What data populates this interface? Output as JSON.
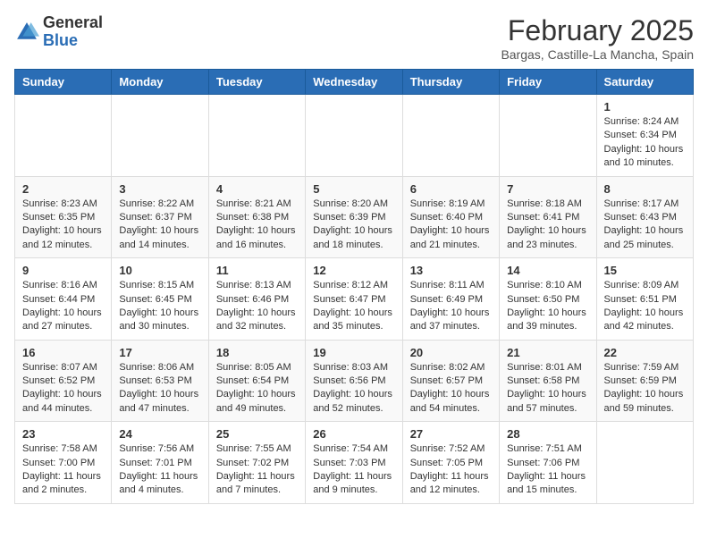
{
  "header": {
    "logo_general": "General",
    "logo_blue": "Blue",
    "month_title": "February 2025",
    "location": "Bargas, Castille-La Mancha, Spain"
  },
  "weekdays": [
    "Sunday",
    "Monday",
    "Tuesday",
    "Wednesday",
    "Thursday",
    "Friday",
    "Saturday"
  ],
  "weeks": [
    [
      {
        "day": "",
        "info": ""
      },
      {
        "day": "",
        "info": ""
      },
      {
        "day": "",
        "info": ""
      },
      {
        "day": "",
        "info": ""
      },
      {
        "day": "",
        "info": ""
      },
      {
        "day": "",
        "info": ""
      },
      {
        "day": "1",
        "info": "Sunrise: 8:24 AM\nSunset: 6:34 PM\nDaylight: 10 hours\nand 10 minutes."
      }
    ],
    [
      {
        "day": "2",
        "info": "Sunrise: 8:23 AM\nSunset: 6:35 PM\nDaylight: 10 hours\nand 12 minutes."
      },
      {
        "day": "3",
        "info": "Sunrise: 8:22 AM\nSunset: 6:37 PM\nDaylight: 10 hours\nand 14 minutes."
      },
      {
        "day": "4",
        "info": "Sunrise: 8:21 AM\nSunset: 6:38 PM\nDaylight: 10 hours\nand 16 minutes."
      },
      {
        "day": "5",
        "info": "Sunrise: 8:20 AM\nSunset: 6:39 PM\nDaylight: 10 hours\nand 18 minutes."
      },
      {
        "day": "6",
        "info": "Sunrise: 8:19 AM\nSunset: 6:40 PM\nDaylight: 10 hours\nand 21 minutes."
      },
      {
        "day": "7",
        "info": "Sunrise: 8:18 AM\nSunset: 6:41 PM\nDaylight: 10 hours\nand 23 minutes."
      },
      {
        "day": "8",
        "info": "Sunrise: 8:17 AM\nSunset: 6:43 PM\nDaylight: 10 hours\nand 25 minutes."
      }
    ],
    [
      {
        "day": "9",
        "info": "Sunrise: 8:16 AM\nSunset: 6:44 PM\nDaylight: 10 hours\nand 27 minutes."
      },
      {
        "day": "10",
        "info": "Sunrise: 8:15 AM\nSunset: 6:45 PM\nDaylight: 10 hours\nand 30 minutes."
      },
      {
        "day": "11",
        "info": "Sunrise: 8:13 AM\nSunset: 6:46 PM\nDaylight: 10 hours\nand 32 minutes."
      },
      {
        "day": "12",
        "info": "Sunrise: 8:12 AM\nSunset: 6:47 PM\nDaylight: 10 hours\nand 35 minutes."
      },
      {
        "day": "13",
        "info": "Sunrise: 8:11 AM\nSunset: 6:49 PM\nDaylight: 10 hours\nand 37 minutes."
      },
      {
        "day": "14",
        "info": "Sunrise: 8:10 AM\nSunset: 6:50 PM\nDaylight: 10 hours\nand 39 minutes."
      },
      {
        "day": "15",
        "info": "Sunrise: 8:09 AM\nSunset: 6:51 PM\nDaylight: 10 hours\nand 42 minutes."
      }
    ],
    [
      {
        "day": "16",
        "info": "Sunrise: 8:07 AM\nSunset: 6:52 PM\nDaylight: 10 hours\nand 44 minutes."
      },
      {
        "day": "17",
        "info": "Sunrise: 8:06 AM\nSunset: 6:53 PM\nDaylight: 10 hours\nand 47 minutes."
      },
      {
        "day": "18",
        "info": "Sunrise: 8:05 AM\nSunset: 6:54 PM\nDaylight: 10 hours\nand 49 minutes."
      },
      {
        "day": "19",
        "info": "Sunrise: 8:03 AM\nSunset: 6:56 PM\nDaylight: 10 hours\nand 52 minutes."
      },
      {
        "day": "20",
        "info": "Sunrise: 8:02 AM\nSunset: 6:57 PM\nDaylight: 10 hours\nand 54 minutes."
      },
      {
        "day": "21",
        "info": "Sunrise: 8:01 AM\nSunset: 6:58 PM\nDaylight: 10 hours\nand 57 minutes."
      },
      {
        "day": "22",
        "info": "Sunrise: 7:59 AM\nSunset: 6:59 PM\nDaylight: 10 hours\nand 59 minutes."
      }
    ],
    [
      {
        "day": "23",
        "info": "Sunrise: 7:58 AM\nSunset: 7:00 PM\nDaylight: 11 hours\nand 2 minutes."
      },
      {
        "day": "24",
        "info": "Sunrise: 7:56 AM\nSunset: 7:01 PM\nDaylight: 11 hours\nand 4 minutes."
      },
      {
        "day": "25",
        "info": "Sunrise: 7:55 AM\nSunset: 7:02 PM\nDaylight: 11 hours\nand 7 minutes."
      },
      {
        "day": "26",
        "info": "Sunrise: 7:54 AM\nSunset: 7:03 PM\nDaylight: 11 hours\nand 9 minutes."
      },
      {
        "day": "27",
        "info": "Sunrise: 7:52 AM\nSunset: 7:05 PM\nDaylight: 11 hours\nand 12 minutes."
      },
      {
        "day": "28",
        "info": "Sunrise: 7:51 AM\nSunset: 7:06 PM\nDaylight: 11 hours\nand 15 minutes."
      },
      {
        "day": "",
        "info": ""
      }
    ]
  ]
}
